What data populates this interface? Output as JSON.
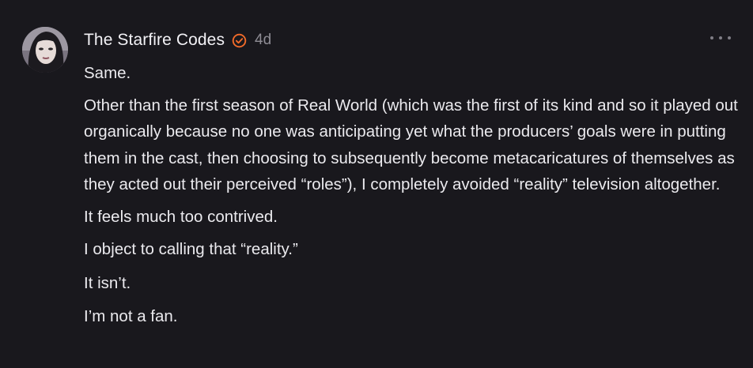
{
  "comment": {
    "author": "The Starfire Codes",
    "age": "4d",
    "verified_icon": "verified-badge-icon",
    "more_icon": "more-options-icon",
    "accent_color": "#f26b2a",
    "paragraphs": [
      "Same.",
      "Other than the first season of Real World (which was the first of its kind and so it played out organically because no one was anticipating yet what the producers’ goals were in putting them in the cast, then choosing to subsequently become metacaricatures of themselves as they acted out their perceived “roles”), I completely avoided “reality” television altogether.",
      "It feels much too contrived.",
      "I object to calling that “reality.”",
      "It isn’t.",
      "I’m not a fan."
    ]
  }
}
